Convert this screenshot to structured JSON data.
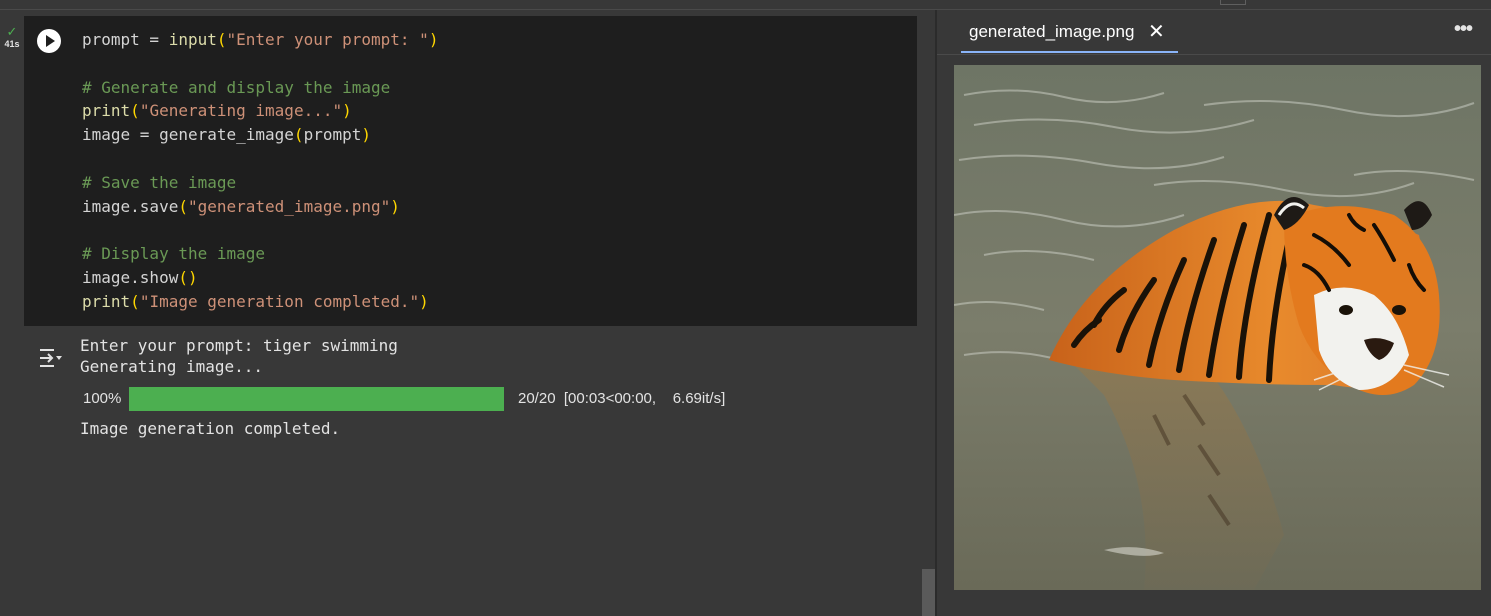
{
  "cell": {
    "status_time": "41s",
    "code_lines": [
      [
        {
          "t": "prompt = ",
          "c": "tx"
        },
        {
          "t": "input",
          "c": "kw"
        },
        {
          "t": "(",
          "c": "pa"
        },
        {
          "t": "\"Enter your prompt: \"",
          "c": "st"
        },
        {
          "t": ")",
          "c": "pa"
        }
      ],
      [],
      [
        {
          "t": "# Generate and display the image",
          "c": "cm"
        }
      ],
      [
        {
          "t": "print",
          "c": "kw"
        },
        {
          "t": "(",
          "c": "pa"
        },
        {
          "t": "\"Generating image...\"",
          "c": "st"
        },
        {
          "t": ")",
          "c": "pa"
        }
      ],
      [
        {
          "t": "image = generate_image",
          "c": "tx"
        },
        {
          "t": "(",
          "c": "pa"
        },
        {
          "t": "prompt",
          "c": "tx"
        },
        {
          "t": ")",
          "c": "pa"
        }
      ],
      [],
      [
        {
          "t": "# Save the image",
          "c": "cm"
        }
      ],
      [
        {
          "t": "image.save",
          "c": "tx"
        },
        {
          "t": "(",
          "c": "pa"
        },
        {
          "t": "\"generated_image.png\"",
          "c": "st"
        },
        {
          "t": ")",
          "c": "pa"
        }
      ],
      [],
      [
        {
          "t": "# Display the image",
          "c": "cm"
        }
      ],
      [
        {
          "t": "image.show",
          "c": "tx"
        },
        {
          "t": "()",
          "c": "pa"
        }
      ],
      [
        {
          "t": "print",
          "c": "kw"
        },
        {
          "t": "(",
          "c": "pa"
        },
        {
          "t": "\"Image generation completed.\"",
          "c": "st"
        },
        {
          "t": ")",
          "c": "pa"
        }
      ]
    ]
  },
  "output": {
    "line1": "Enter your prompt: tiger swimming",
    "line2": "Generating image...",
    "progress": {
      "percent_label": "100%",
      "fraction": 1.0,
      "info": "20/20  [00:03<00:00,    6.69it/s]"
    },
    "line3": "Image generation completed."
  },
  "viewer": {
    "tab_label": "generated_image.png",
    "close_glyph": "✕",
    "more_glyph": "•••"
  },
  "icons": {
    "check": "check-icon",
    "run": "play-icon",
    "output_toggle": "output-toggle-icon",
    "close": "close-icon",
    "more": "more-horizontal-icon"
  },
  "colors": {
    "progress_fill": "#4caf50",
    "tab_underline": "#8ab4f8",
    "code_bg": "#1e1e1e"
  }
}
